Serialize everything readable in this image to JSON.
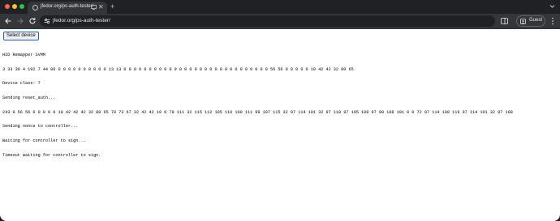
{
  "tab": {
    "title": "jfedor.org/ps-auth-tester/",
    "close_glyph": "✕",
    "new_tab_glyph": "+"
  },
  "toolbar": {
    "url": "jfedor.org/ps-auth-tester/",
    "profile_label": "Guest"
  },
  "page": {
    "select_button_label": "Select device",
    "log_lines": [
      "HID Remapper SVMM",
      "3 33 39 4 192 7 44 86 0 0 0 0 0 0 0 0 0 0 13 13 0 0 0 0 0 0 0 0 0 0 0 0 0 0 0 0 0 0 0 0 0 0 0 0 0 0 0 0 0 56 56 0 0 0 0 0 10 42 42 32 80 65",
      "Device class: 7",
      "Sending reset_auth...",
      "243 0 56 56 0 0 0 0 0 10 42 42 42 32 80 65 78 73 67 32 42 42 10 0 78 111 32 115 112 105 110 100 111 99 107 115 32 97 114 101 32 97 118 97 105 108 97 98 108 101 0 0 72 97 114 100 119 97 114 101 32 97 108",
      "Sending nonce to controller...",
      "Waiting for controller to sign...",
      "Timeout waiting for controller to sign."
    ]
  },
  "colors": {
    "tab_strip_bg": "#202124",
    "toolbar_bg": "#35363a",
    "button_border": "#1a5fd6"
  },
  "icons": [
    "site-favicon-icon",
    "media-icon",
    "close-icon",
    "new-tab-icon",
    "tab-search-icon",
    "back-arrow-icon",
    "forward-arrow-icon",
    "reload-icon",
    "site-info-icon",
    "profile-icon",
    "more-menu-icon"
  ]
}
